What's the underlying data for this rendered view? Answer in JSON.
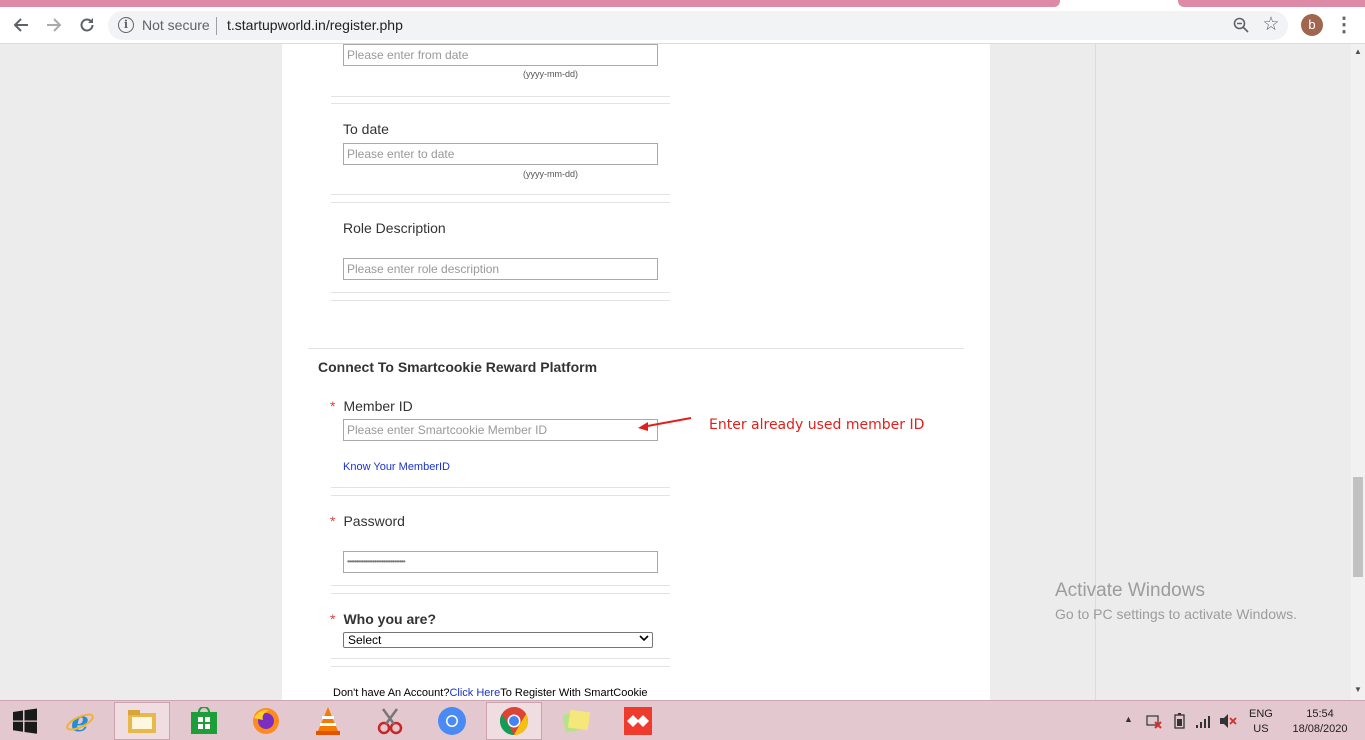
{
  "browser": {
    "security_label": "Not secure",
    "url": "t.startupworld.in/register.php",
    "profile_initial": "b"
  },
  "form": {
    "from_date": {
      "placeholder": "Please enter from date",
      "hint": "(yyyy-mm-dd)"
    },
    "to_date": {
      "label": "To date",
      "placeholder": "Please enter to date",
      "hint": "(yyyy-mm-dd)"
    },
    "role_description": {
      "label": "Role Description",
      "placeholder": "Please enter role description"
    },
    "section_title": "Connect To Smartcookie Reward Platform",
    "member_id": {
      "required_mark": "*",
      "label": "Member ID",
      "placeholder": "Please enter Smartcookie Member ID",
      "link": "Know Your MemberID"
    },
    "password": {
      "required_mark": "*",
      "label": "Password",
      "value": "••••••••••••••••••••••••••••••••"
    },
    "who_you_are": {
      "required_mark": "*",
      "label": "Who you are?",
      "selected": "Select"
    },
    "footer": {
      "prefix": "Don't have An Account?",
      "link": "Click Here",
      "suffix": "To Register With SmartCookie"
    }
  },
  "annotation": {
    "text": "Enter already used member ID",
    "color": "#e0201c"
  },
  "watermark": {
    "line1": "Activate Windows",
    "line2": "Go to PC settings to activate Windows."
  },
  "tray": {
    "lang1": "ENG",
    "lang2": "US",
    "time": "15:54",
    "date": "18/08/2020"
  }
}
